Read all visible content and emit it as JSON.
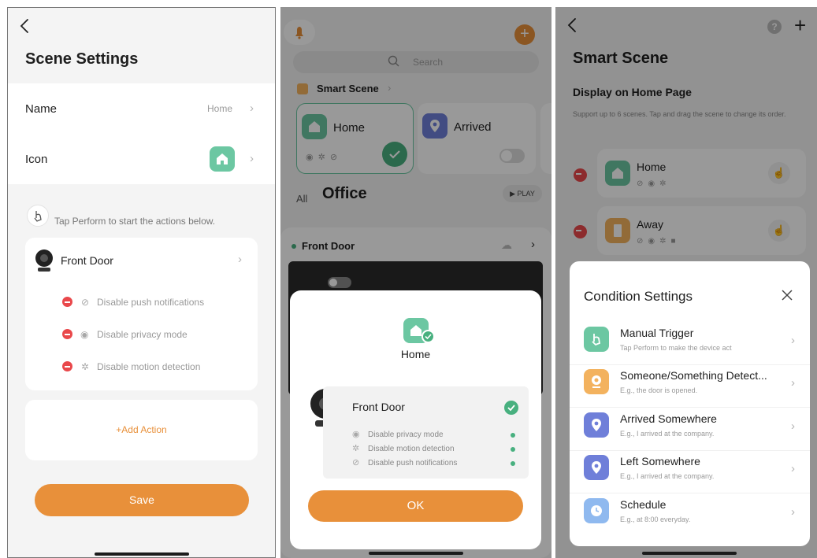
{
  "panel1": {
    "title": "Scene Settings",
    "name_label": "Name",
    "name_value": "Home",
    "icon_label": "Icon",
    "hint": "Tap Perform to start the actions below.",
    "device_name": "Front Door",
    "actions": [
      "Disable push notifications",
      "Disable privacy mode",
      "Disable motion detection"
    ],
    "add_action": "+Add Action",
    "save": "Save"
  },
  "panel2": {
    "search_placeholder": "Search",
    "smart_scene": "Smart Scene",
    "scenes": [
      {
        "label": "Home"
      },
      {
        "label": "Arrived"
      }
    ],
    "tab_all": "All",
    "room": "Office",
    "play": "PLAY",
    "device_row": "Front Door",
    "modal": {
      "scene_name": "Home",
      "device": "Front Door",
      "actions": [
        "Disable privacy mode",
        "Disable motion detection",
        "Disable push notifications"
      ],
      "ok": "OK"
    }
  },
  "panel3": {
    "title": "Smart Scene",
    "section_title": "Display on Home Page",
    "section_desc": "Support up to 6 scenes. Tap and drag the scene to change its order.",
    "scenes": [
      {
        "label": "Home"
      },
      {
        "label": "Away"
      }
    ],
    "sheet": {
      "title": "Condition Settings",
      "items": [
        {
          "title": "Manual Trigger",
          "desc": "Tap Perform to make the device act",
          "color": "#6cc7a2"
        },
        {
          "title": "Someone/Something Detect...",
          "desc": "E.g., the door is opened.",
          "color": "#f3b25e"
        },
        {
          "title": "Arrived Somewhere",
          "desc": "E.g., I arrived at the company.",
          "color": "#6f7fd9"
        },
        {
          "title": "Left Somewhere",
          "desc": "E.g., I arrived at the company.",
          "color": "#6f7fd9"
        },
        {
          "title": "Schedule",
          "desc": "E.g., at 8:00 everyday.",
          "color": "#8fb9ef"
        }
      ]
    }
  },
  "colors": {
    "accent": "#e8903a",
    "green": "#6cc7a2",
    "success": "#48b07f",
    "danger": "#e9484b"
  }
}
